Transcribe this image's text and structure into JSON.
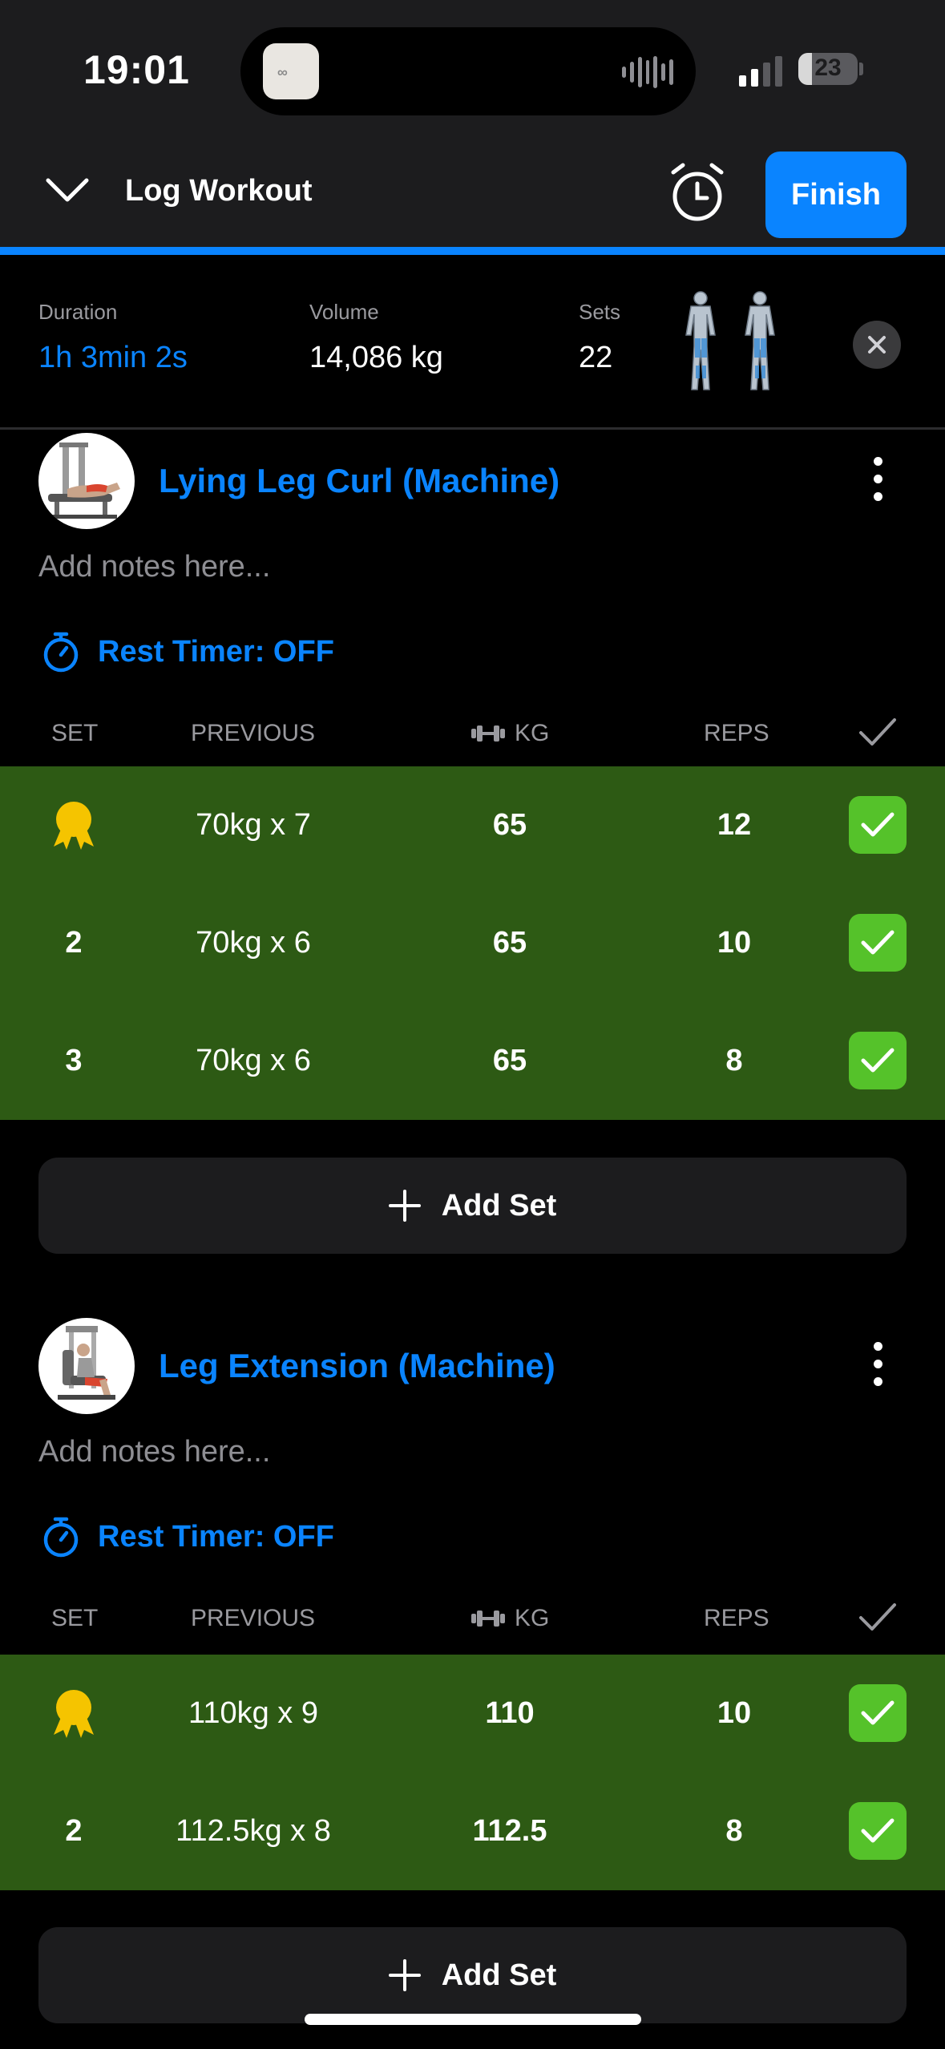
{
  "status_bar": {
    "time": "19:01",
    "battery": "23",
    "battery_fraction": 0.23
  },
  "header": {
    "title": "Log Workout",
    "finish_label": "Finish",
    "progress_fraction": 1.0
  },
  "summary": {
    "duration_label": "Duration",
    "duration_value": "1h 3min 2s",
    "volume_label": "Volume",
    "volume_value": "14,086 kg",
    "sets_label": "Sets",
    "sets_value": "22"
  },
  "columns": {
    "set": "SET",
    "previous": "PREVIOUS",
    "kg": "KG",
    "reps": "REPS"
  },
  "exercises": [
    {
      "title": "Lying Leg Curl (Machine)",
      "notes_placeholder": "Add notes here...",
      "rest_timer": "Rest Timer: OFF",
      "add_set_label": "Add Set",
      "sets": [
        {
          "set": "",
          "previous": "70kg x 7",
          "kg": "65",
          "reps": "12",
          "done": true,
          "icon": "medal-icon"
        },
        {
          "set": "2",
          "previous": "70kg x 6",
          "kg": "65",
          "reps": "10",
          "done": true
        },
        {
          "set": "3",
          "previous": "70kg x 6",
          "kg": "65",
          "reps": "8",
          "done": true
        }
      ]
    },
    {
      "title": "Leg Extension (Machine)",
      "notes_placeholder": "Add notes here...",
      "rest_timer": "Rest Timer: OFF",
      "add_set_label": "Add Set",
      "sets": [
        {
          "set": "",
          "previous": "110kg x 9",
          "kg": "110",
          "reps": "10",
          "done": true,
          "icon": "medal-icon"
        },
        {
          "set": "2",
          "previous": "112.5kg x 8",
          "kg": "112.5",
          "reps": "8",
          "done": true
        }
      ]
    }
  ],
  "colors": {
    "accent": "#0a84ff",
    "completed_row": "#2d5a14",
    "check": "#55c22a",
    "medal": "#f5c400"
  }
}
